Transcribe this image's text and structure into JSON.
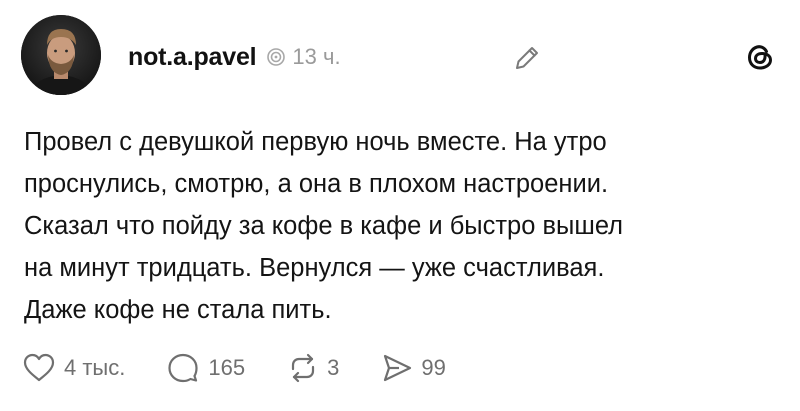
{
  "author": {
    "username": "not.a.pavel",
    "timestamp": "13 ч."
  },
  "icons": {
    "avatar": "profile-photo",
    "visibility": "visibility-icon",
    "edit": "pencil-icon",
    "app_logo": "threads-logo",
    "like": "heart-icon",
    "reply": "comment-icon",
    "repost": "repost-icon",
    "share": "send-icon"
  },
  "post": {
    "lines": [
      "Провел с девушкой первую ночь вместе. На утро",
      "проснулись, смотрю, а она в плохом настроении.",
      "Сказал что пойду за кофе в кафе и быстро вышел",
      "на минут тридцать. Вернулся — уже счастливая.",
      "Даже кофе не стала пить."
    ]
  },
  "actions": {
    "likes": "4 тыс.",
    "replies": "165",
    "reposts": "3",
    "shares": "99"
  },
  "colors": {
    "text": "#141414",
    "muted": "#9a9a9a",
    "icon": "#6f6f6f",
    "background": "#ffffff"
  }
}
